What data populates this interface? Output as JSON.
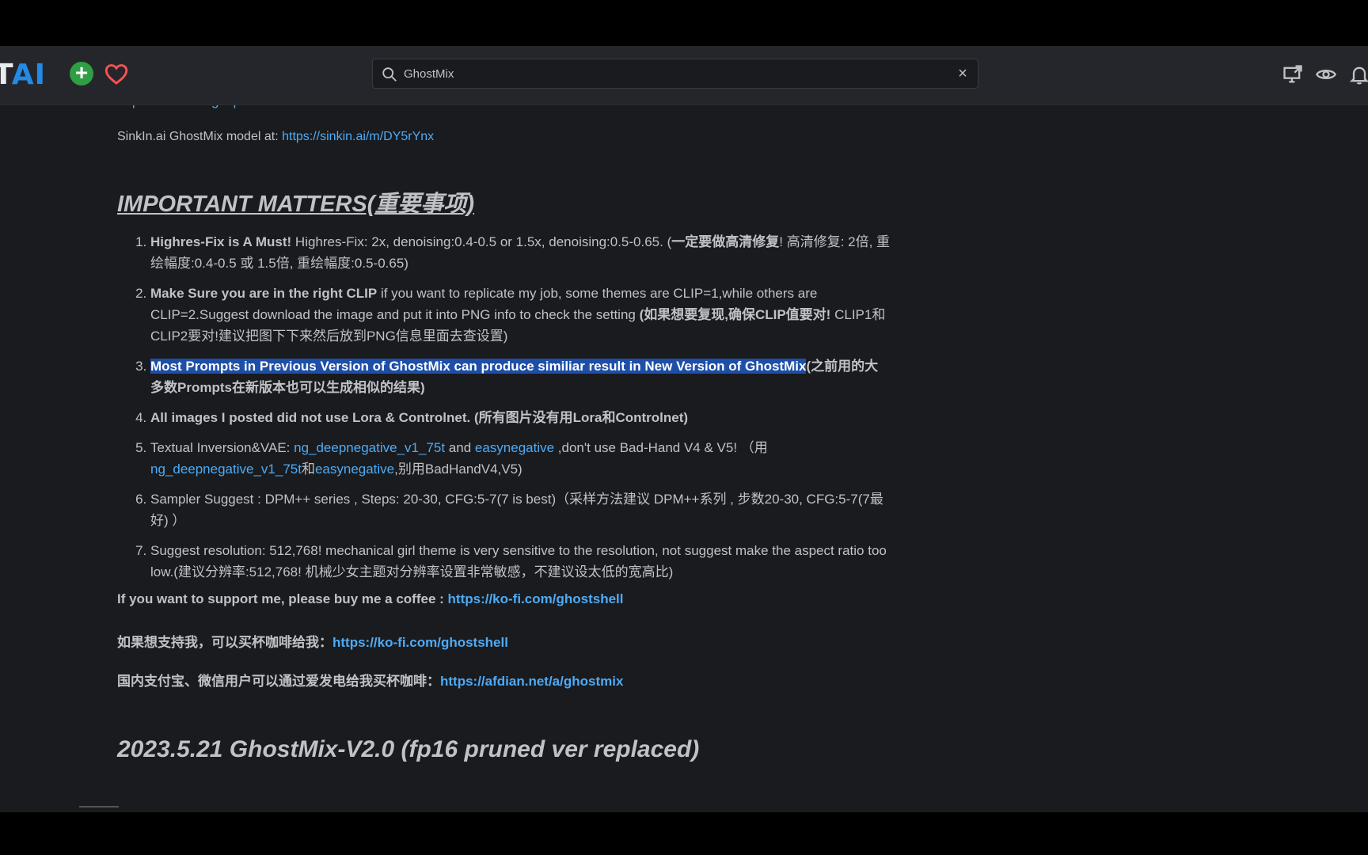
{
  "header": {
    "logo_left": "T",
    "logo_right": "AI",
    "add_label": "+",
    "search_value": "GhostMix",
    "clear_label": "×"
  },
  "content": {
    "cut_link": "https://www.imagespace/a/GhostMix",
    "sinkin_label": "SinkIn.ai GhostMix model at: ",
    "sinkin_link": "https://sinkin.ai/m/DY5rYnx",
    "important_heading": "IMPORTANT MATTERS(重要事项)",
    "items": [
      {
        "bold": "Highres-Fix is A Must!",
        "text": " Highres-Fix: 2x, denoising:0.4-0.5 or 1.5x, denoising:0.5-0.65. (",
        "bold2": "一定要做高清修复",
        "text2": "! 高清修复: 2倍, 重绘幅度:0.4-0.5 或 1.5倍, 重绘幅度:0.5-0.65)"
      },
      {
        "bold": "Make Sure you are in the right CLIP",
        "text": " if you want to replicate my job, some themes are CLIP=1,while others are CLIP=2.Suggest download the image and put it into PNG info to check the setting ",
        "bold2": "(如果想要复现,确保CLIP值要对!",
        "text2": " CLIP1和CLIP2要对!建议把图下下来然后放到PNG信息里面去查设置)"
      },
      {
        "highlight": "Most Prompts in Previous Version of GhostMix can produce similiar result in New Version of GhostMix",
        "bold2": "(之前用的大多数Prompts在新版本也可以生成相似的结果)"
      },
      {
        "bold": "All images I posted did not use Lora & Controlnet. (所有图片没有用Lora和Controlnet)"
      },
      {
        "text": "Textual Inversion&VAE: ",
        "link1": "ng_deepnegative_v1_75t",
        "text_and": " and ",
        "link2": "easynegative",
        "text2": " ,don't use Bad-Hand V4 & V5!  （用",
        "link3": "ng_deepnegative_v1_75t",
        "text_he": "和",
        "link4": "easynegative",
        "text3": ",别用BadHandV4,V5)"
      },
      {
        "text": "Sampler Suggest : DPM++ series , Steps: 20-30, CFG:5-7(7 is best)（采样方法建议 DPM++系列 , 步数20-30, CFG:5-7(7最好) ）"
      },
      {
        "text": "Suggest resolution: 512,768! mechanical girl theme is very sensitive to the resolution, not suggest make the aspect ratio too low.(建议分辨率:512,768! 机械少女主题对分辨率设置非常敏感，不建议设太低的宽高比)"
      }
    ],
    "support_en": "If you want to support me, please buy me a coffee : ",
    "support_en_link": "https://ko-fi.com/ghostshell",
    "support_cn": "如果想支持我，可以买杯咖啡给我：",
    "support_cn_link": "https://ko-fi.com/ghostshell",
    "support_cn2": "国内支付宝、微信用户可以通过爱发电给我买杯咖啡：",
    "support_cn2_link": "https://afdian.net/a/ghostmix",
    "version_heading": "2023.5.21 GhostMix-V2.0 (fp16 pruned ver replaced)"
  }
}
